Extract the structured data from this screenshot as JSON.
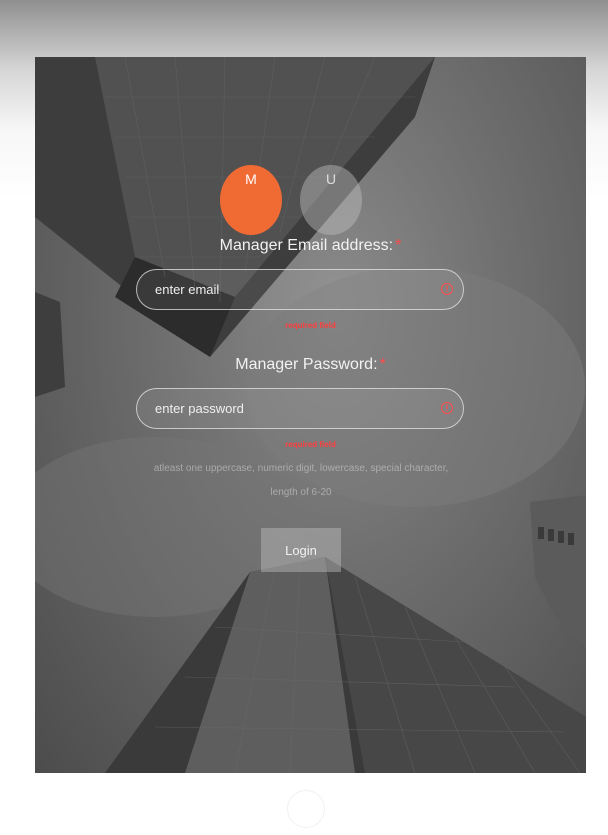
{
  "roles": {
    "manager_initial": "M",
    "user_initial": "U"
  },
  "form": {
    "email_label": "Manager Email address:",
    "email_placeholder": "enter email",
    "email_error": "required field",
    "password_label": "Manager Password:",
    "password_placeholder": "enter password",
    "password_error": "required field",
    "required_marker": "*",
    "password_hint": "atleast one uppercase, numeric digit, lowercase, special character, length of 6-20",
    "login_label": "Login"
  },
  "colors": {
    "accent": "#f06a34",
    "error": "#ff3d3d"
  },
  "icons": [
    "warning-circle-icon",
    "warning-circle-icon"
  ]
}
